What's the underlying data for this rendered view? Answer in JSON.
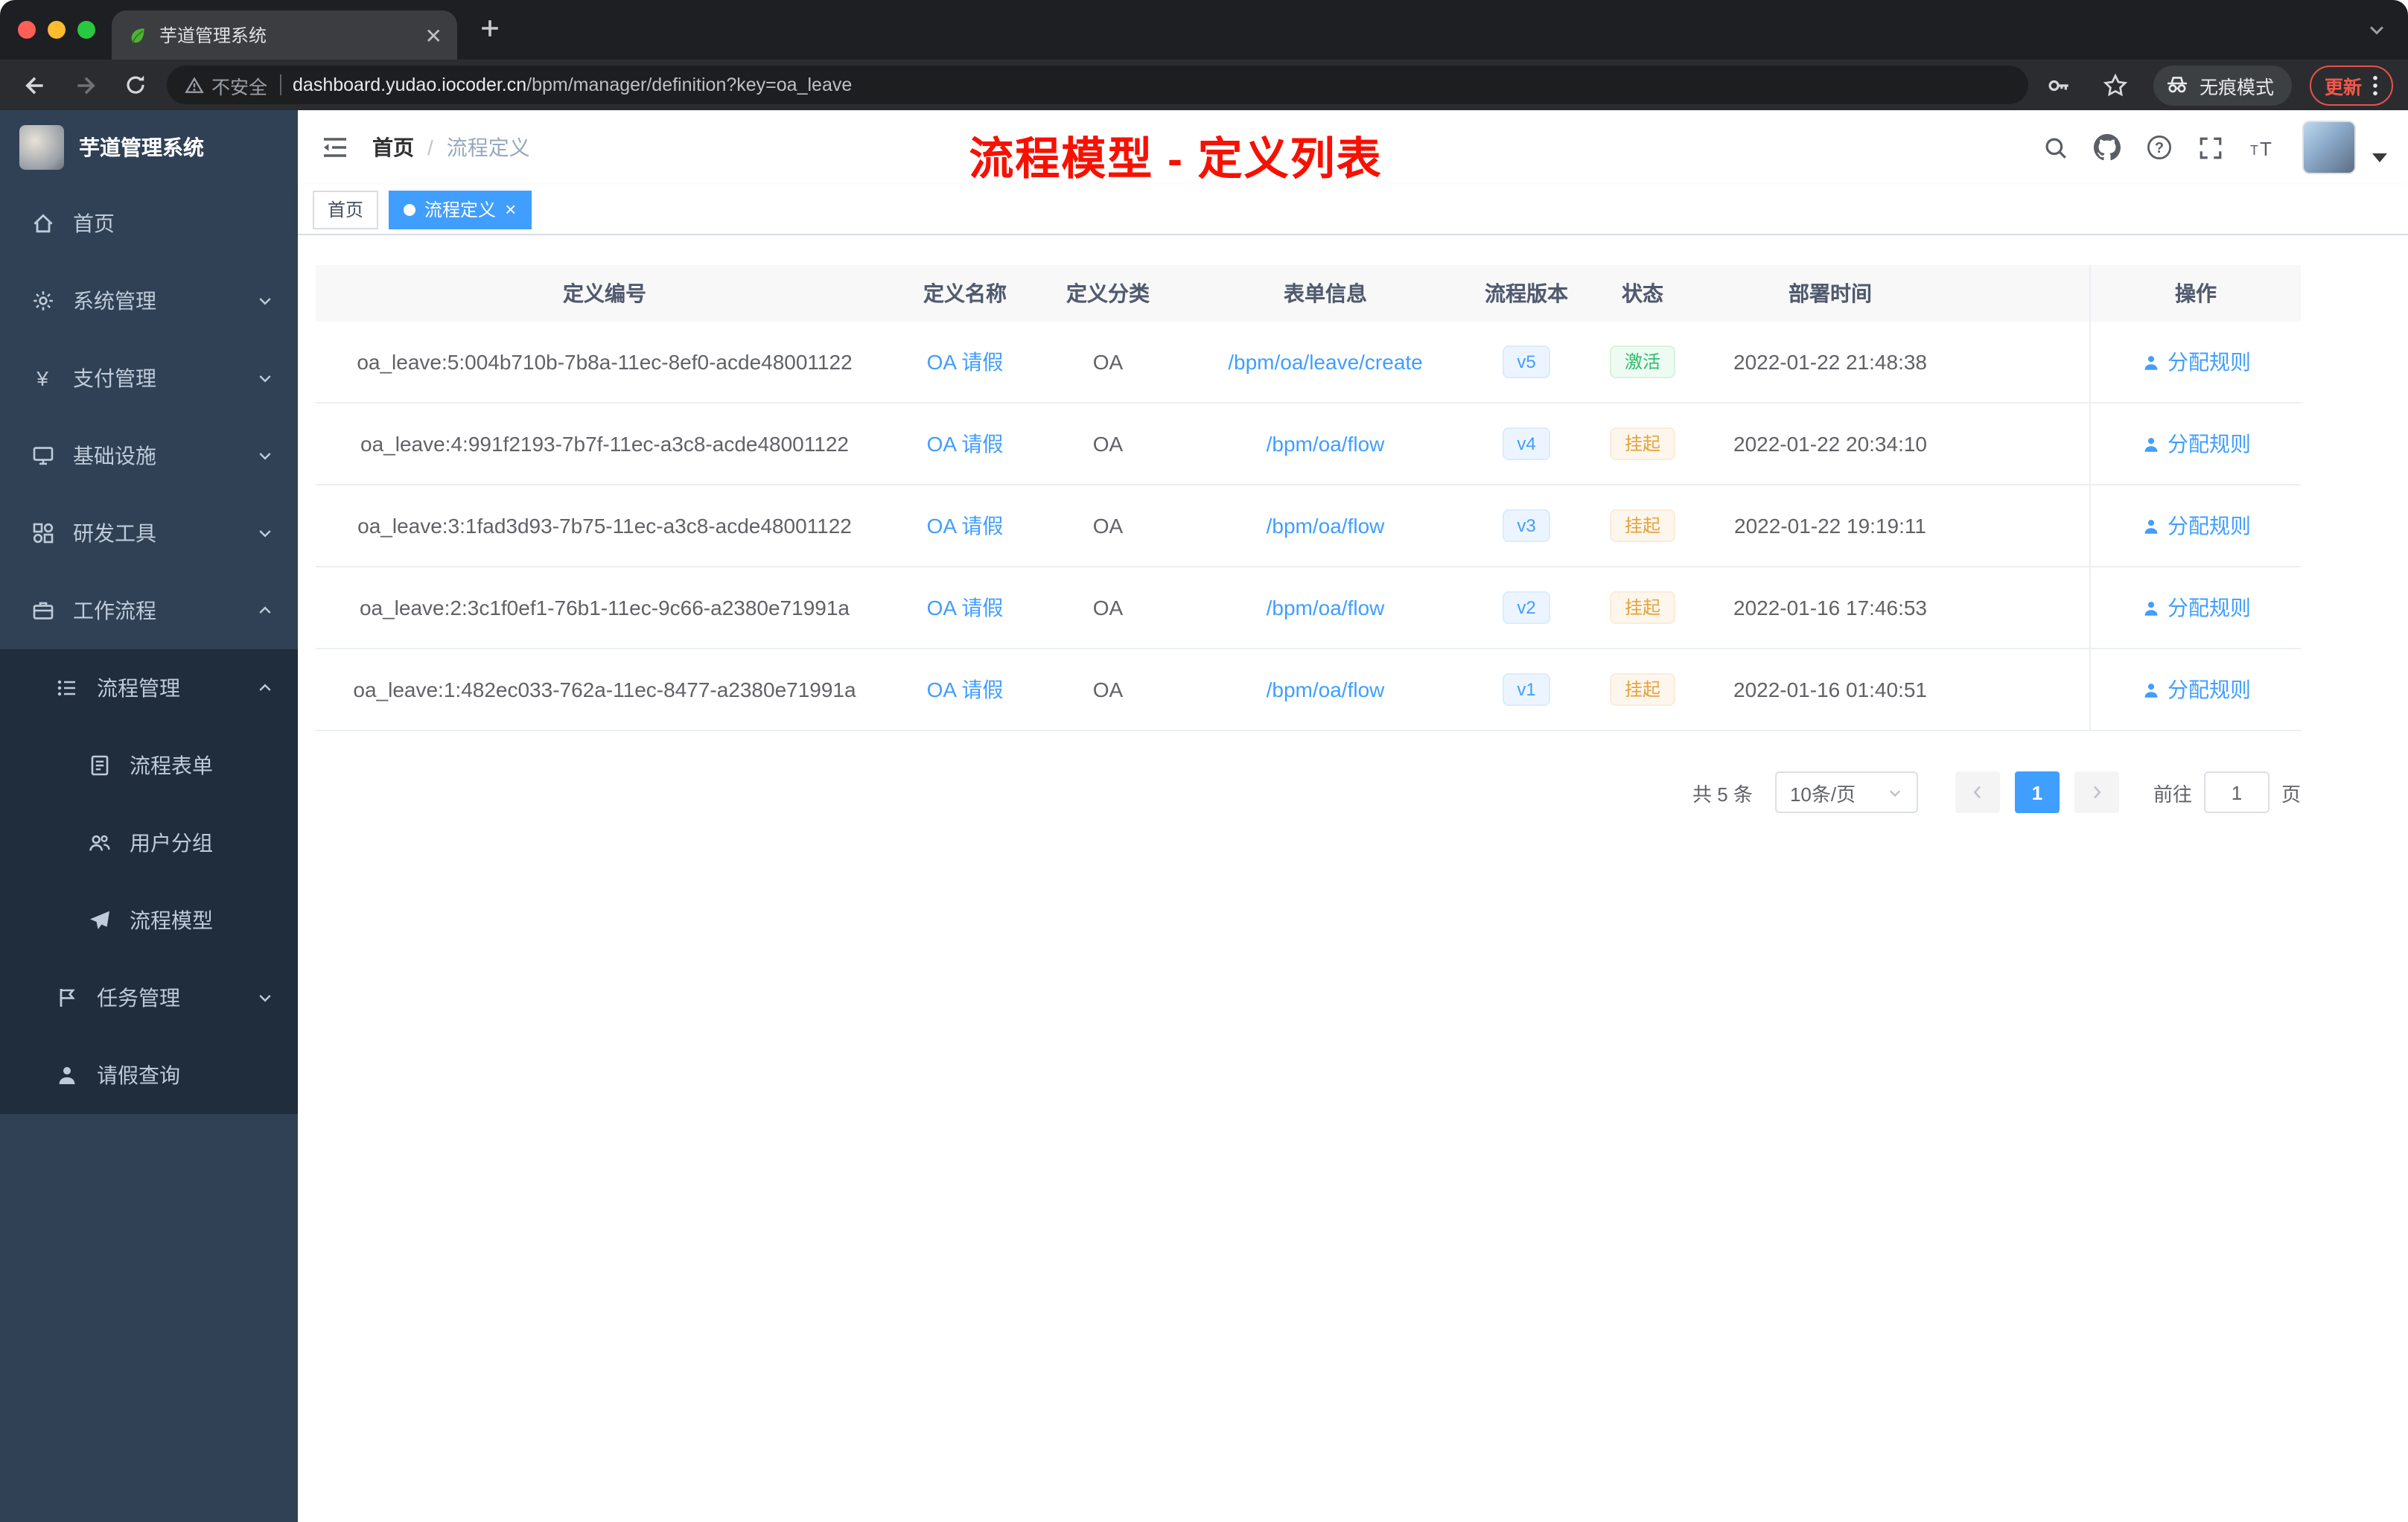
{
  "colors": {
    "accent": "#409eff",
    "success_text": "#2dbd6e",
    "warning_text": "#e6a23c",
    "annotation_red": "#f81000",
    "sidebar_bg": "#304156",
    "submenu_bg": "#1f2d3d",
    "active_tag_bg": "#409eff"
  },
  "browser": {
    "tab_title": "芋道管理系统",
    "security_label": "不安全",
    "url_host": "dashboard.yudao.iocoder.cn",
    "url_path": "/bpm/manager/definition?key=oa_leave",
    "incognito_label": "无痕模式",
    "update_label": "更新"
  },
  "sidebar": {
    "logo_title": "芋道管理系统",
    "menu": [
      {
        "label": "首页",
        "icon": "home-icon"
      },
      {
        "label": "系统管理",
        "icon": "gear-icon"
      },
      {
        "label": "支付管理",
        "icon": "yen-icon"
      },
      {
        "label": "基础设施",
        "icon": "monitor-icon"
      },
      {
        "label": "研发工具",
        "icon": "component-icon"
      },
      {
        "label": "工作流程",
        "icon": "briefcase-icon"
      }
    ],
    "submenu": {
      "process_label": "流程管理",
      "children": [
        {
          "label": "流程表单",
          "icon": "form-icon"
        },
        {
          "label": "用户分组",
          "icon": "user-group-icon"
        },
        {
          "label": "流程模型",
          "icon": "paper-plane-icon"
        }
      ],
      "task_label": "任务管理",
      "leave_label": "请假查询"
    }
  },
  "header": {
    "breadcrumb": {
      "home": "首页",
      "separator": "/",
      "current": "流程定义"
    },
    "annotation": "流程模型 - 定义列表"
  },
  "tags": {
    "home": "首页",
    "active": "流程定义"
  },
  "table": {
    "columns": [
      "定义编号",
      "定义名称",
      "定义分类",
      "表单信息",
      "流程版本",
      "状态",
      "部署时间",
      "操作"
    ],
    "rows": [
      {
        "id": "oa_leave:5:004b710b-7b8a-11ec-8ef0-acde48001122",
        "name": "OA 请假",
        "category": "OA",
        "form": "/bpm/oa/leave/create",
        "version": "v5",
        "status": "激活",
        "status_type": "success",
        "time": "2022-01-22 21:48:38",
        "action": "分配规则"
      },
      {
        "id": "oa_leave:4:991f2193-7b7f-11ec-a3c8-acde48001122",
        "name": "OA 请假",
        "category": "OA",
        "form": "/bpm/oa/flow",
        "version": "v4",
        "status": "挂起",
        "status_type": "warning",
        "time": "2022-01-22 20:34:10",
        "action": "分配规则"
      },
      {
        "id": "oa_leave:3:1fad3d93-7b75-11ec-a3c8-acde48001122",
        "name": "OA 请假",
        "category": "OA",
        "form": "/bpm/oa/flow",
        "version": "v3",
        "status": "挂起",
        "status_type": "warning",
        "time": "2022-01-22 19:19:11",
        "action": "分配规则"
      },
      {
        "id": "oa_leave:2:3c1f0ef1-76b1-11ec-9c66-a2380e71991a",
        "name": "OA 请假",
        "category": "OA",
        "form": "/bpm/oa/flow",
        "version": "v2",
        "status": "挂起",
        "status_type": "warning",
        "time": "2022-01-16 17:46:53",
        "action": "分配规则"
      },
      {
        "id": "oa_leave:1:482ec033-762a-11ec-8477-a2380e71991a",
        "name": "OA 请假",
        "category": "OA",
        "form": "/bpm/oa/flow",
        "version": "v1",
        "status": "挂起",
        "status_type": "warning",
        "time": "2022-01-16 01:40:51",
        "action": "分配规则"
      }
    ]
  },
  "pagination": {
    "total": "共 5 条",
    "page_size": "10条/页",
    "current_page": "1",
    "goto_label": "前往",
    "goto_value": "1",
    "page_unit": "页"
  }
}
